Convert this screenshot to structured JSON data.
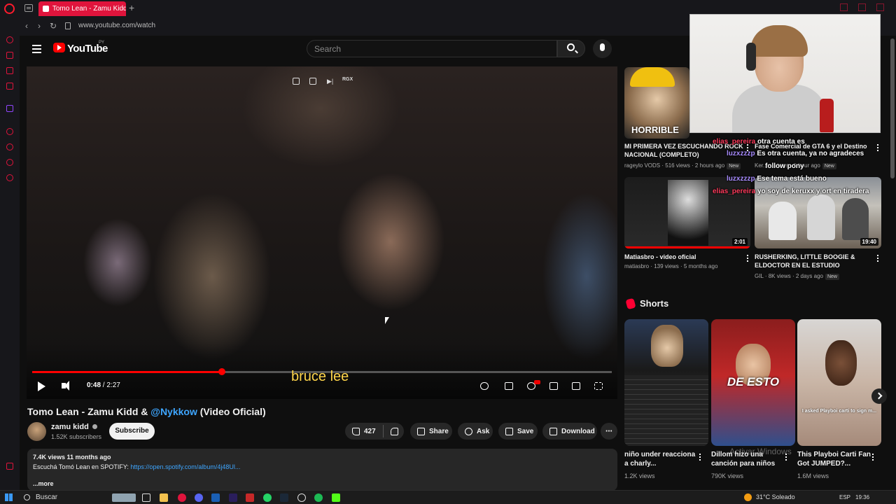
{
  "browser": {
    "tab_title": "Tomo Lean - Zamu Kidd",
    "new_tab_symbol": "+",
    "url": "www.youtube.com/watch"
  },
  "youtube": {
    "wordmark": "YouTube",
    "country": "PY",
    "search_placeholder": "Search"
  },
  "player": {
    "current_time": "0:48",
    "duration": "2:27",
    "progress_fraction": 0.327,
    "caption": "bruce lee",
    "top_label": "RGX"
  },
  "video": {
    "title_main": "Tomo Lean - Zamu Kidd & ",
    "title_mention": "@Nykkow",
    "title_suffix": " (Video Oficial)",
    "channel_name": "zamu kidd",
    "subscribers": "1.52K subscribers",
    "subscribe_label": "Subscribe",
    "like_count": "427",
    "share_label": "Share",
    "ask_label": "Ask",
    "save_label": "Save",
    "download_label": "Download",
    "description_meta": "7.4K views  11 months ago",
    "description_text": "Escuchá Tomó Lean en SPOTIFY: ",
    "description_link": "https://open.spotify.com/album/4j48Ul...",
    "description_more": "...more"
  },
  "recommendations": [
    {
      "title": "MI PRIMERA VEZ ESCUCHANDO ROCK NACIONAL (COMPLETO)",
      "meta": "rageylo VODS · 516 views · 2 hours ago",
      "badge": "New",
      "thumb_text": "HORRIBLE"
    },
    {
      "title": "Fase Comercial de GTA 6 y el Destino",
      "meta": "Ker... · ...iews · 1 hour ago",
      "badge": "New"
    },
    {
      "title": "Matiasbro - video oficial",
      "meta": "matiasbro · 139 views · 5 months ago",
      "duration": "2:01"
    },
    {
      "title": "RUSHERKING, LITTLE BOOGIE & ELDOCTOR EN EL ESTUDIO",
      "meta": "GIL · 8K views · 2 days ago",
      "badge": "New",
      "duration": "19:40"
    }
  ],
  "shorts": {
    "heading": "Shorts",
    "items": [
      {
        "title": "niño under reacciona a charly...",
        "views": "1.2K views"
      },
      {
        "title": "Dillom hizo una canción para niños",
        "views": "790K views",
        "overlay": "DE ESTO"
      },
      {
        "title": "This Playboi Carti Fan Got JUMPED?...",
        "views": "1.6M views",
        "overlay": "I asked Playboi carti to sign m..."
      }
    ]
  },
  "chat": [
    {
      "user": "elias_pereira",
      "message": "otra cuenta es",
      "user_color": "red"
    },
    {
      "user": "luzxzzzp",
      "message": "Es otra cuenta, ya no agradeces",
      "user_color": "purple"
    },
    {
      "user": "",
      "message": "follow pony",
      "user_color": "purple"
    },
    {
      "user": "luzxzzzp",
      "message": "Ese tema está bueno",
      "user_color": "purple"
    },
    {
      "user": "elias_pereira",
      "message": "yo soy de keruxx y ort en tiradera",
      "user_color": "red"
    }
  ],
  "watermark": "Activar Windows",
  "taskbar": {
    "search_label": "Buscar",
    "weather": "31°C  Soleado",
    "language": "ESP",
    "time": "19:36"
  },
  "colors": {
    "accent": "#ff0000",
    "opera": "#e0143c",
    "link": "#3ea6ff"
  }
}
